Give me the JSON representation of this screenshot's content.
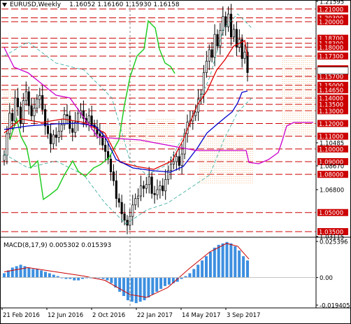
{
  "main_chart": {
    "symbol_label": "EURUSD,Weekly",
    "ohlc_text": "1.16052 1.16160 1.15930 1.16158",
    "current_price_label": "1.16158"
  },
  "macd": {
    "header": "MACD(8,17,9) 0.005302 0.015393",
    "axis_labels": [
      "0.025396",
      "0.00",
      "-0.019405"
    ]
  },
  "date_labels": [
    "21 Feb 2016",
    "12 Jun 2016",
    "2 Oct 2016",
    "22 Jan 2017",
    "14 May 2017",
    "3 Sep 2017"
  ],
  "price_axis_labels": [
    {
      "label": "1.21595",
      "boxed": false
    },
    {
      "label": "1.21000",
      "boxed": true
    },
    {
      "label": "1.20300",
      "boxed": true
    },
    {
      "label": "1.20000",
      "boxed": true
    },
    {
      "label": "1.18700",
      "boxed": true
    },
    {
      "label": "1.18300",
      "boxed": true
    },
    {
      "label": "1.18000",
      "boxed": true
    },
    {
      "label": "1.17300",
      "boxed": true
    },
    {
      "label": "1.16300",
      "boxed": true
    },
    {
      "label": "1.15700",
      "boxed": true
    },
    {
      "label": "1.15000",
      "boxed": true
    },
    {
      "label": "1.14650",
      "boxed": true
    },
    {
      "label": "1.14000",
      "boxed": true
    },
    {
      "label": "1.13500",
      "boxed": true
    },
    {
      "label": "1.13000",
      "boxed": true
    },
    {
      "label": "1.12000",
      "boxed": true
    },
    {
      "label": "1.11000",
      "boxed": true
    },
    {
      "label": "1.10485",
      "boxed": false
    },
    {
      "label": "1.10000",
      "boxed": true
    },
    {
      "label": "1.09000",
      "boxed": true
    },
    {
      "label": "1.08670",
      "boxed": false
    },
    {
      "label": "1.08000",
      "boxed": true
    },
    {
      "label": "1.06800",
      "boxed": false
    },
    {
      "label": "1.05000",
      "boxed": true
    },
    {
      "label": "1.03500",
      "boxed": true
    },
    {
      "label": "1.03115",
      "boxed": false
    }
  ],
  "colors": {
    "candle_bull": "#000000",
    "candle_bear": "#000000",
    "level_line": "#cc0000",
    "bollinger_green": "#00ee00",
    "kijun_blue": "#0000cc",
    "tenkan_red": "#dd0000",
    "chikou_green": "#22cc22",
    "senkou_magenta": "#cc00cc",
    "cloud_orange": "#f4a460",
    "macd_bar": "#3d8fe0",
    "macd_signal": "#cc0000"
  }
}
